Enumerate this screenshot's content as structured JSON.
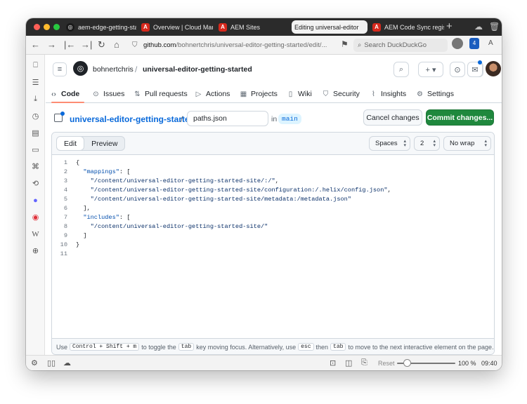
{
  "browser": {
    "tabs": [
      {
        "label": "aem-edge-getting-start",
        "icon": "github-icon"
      },
      {
        "label": "Overview | Cloud Manag",
        "icon": "adobe-icon"
      },
      {
        "label": "AEM Sites",
        "icon": "adobe-icon"
      },
      {
        "label": "Editing universal-editor",
        "icon": "github-icon"
      },
      {
        "label": "AEM Code Sync registra",
        "icon": "adobe-icon"
      }
    ],
    "active_tab_index": 3,
    "url": {
      "domain": "github.com",
      "path": "/bohnertchris/universal-editor-getting-started/edit/..."
    },
    "search_placeholder": "Search DuckDuckGo",
    "extension_badge": "4",
    "reader_label": "A"
  },
  "github": {
    "owner": "bohnertchris",
    "separator": "/",
    "repo": "universal-editor-getting-started",
    "nav_tabs": [
      {
        "label": "Code",
        "icon": "code-icon"
      },
      {
        "label": "Issues",
        "icon": "issue-icon"
      },
      {
        "label": "Pull requests",
        "icon": "pull-request-icon"
      },
      {
        "label": "Actions",
        "icon": "play-icon"
      },
      {
        "label": "Projects",
        "icon": "table-icon"
      },
      {
        "label": "Wiki",
        "icon": "book-icon"
      },
      {
        "label": "Security",
        "icon": "shield-icon"
      },
      {
        "label": "Insights",
        "icon": "graph-icon"
      },
      {
        "label": "Settings",
        "icon": "gear-icon"
      }
    ],
    "selected_nav": "Code",
    "file": {
      "repo_link": "universal-editor-getting-started",
      "path_separator": "/",
      "filename": "paths.json",
      "in_label": "in",
      "branch": "main"
    },
    "buttons": {
      "cancel": "Cancel changes",
      "commit": "Commit changes..."
    },
    "editor": {
      "edit_tab": "Edit",
      "preview_tab": "Preview",
      "indent_mode": "Spaces",
      "indent_size": "2",
      "wrap_mode": "No wrap",
      "lines": [
        "{",
        "  \"mappings\": [",
        "    \"/content/universal-editor-getting-started-site/:/\",",
        "    \"/content/universal-editor-getting-started-site/configuration:/.helix/config.json\",",
        "    \"/content/universal-editor-getting-started-site/metadata:/metadata.json\"",
        "  ],",
        "  \"includes\": [",
        "    \"/content/universal-editor-getting-started-site/\"",
        "  ]",
        "}",
        ""
      ],
      "footer": {
        "use": "Use",
        "shortcut": "Control + Shift + m",
        "to_toggle": "to toggle the",
        "tab_key": "tab",
        "rest": "key moving focus. Alternatively, use",
        "esc_key": "esc",
        "then": "then",
        "tab_key2": "tab",
        "end": "to move to the next interactive element on the page."
      }
    }
  },
  "statusbar": {
    "reset": "Reset",
    "zoom": "100 %",
    "zoom_level": 1.0,
    "time": "09:40"
  },
  "colors": {
    "commit_green": "#1f883d",
    "link_blue": "#0969da",
    "tab_underline": "#fd8c73"
  }
}
